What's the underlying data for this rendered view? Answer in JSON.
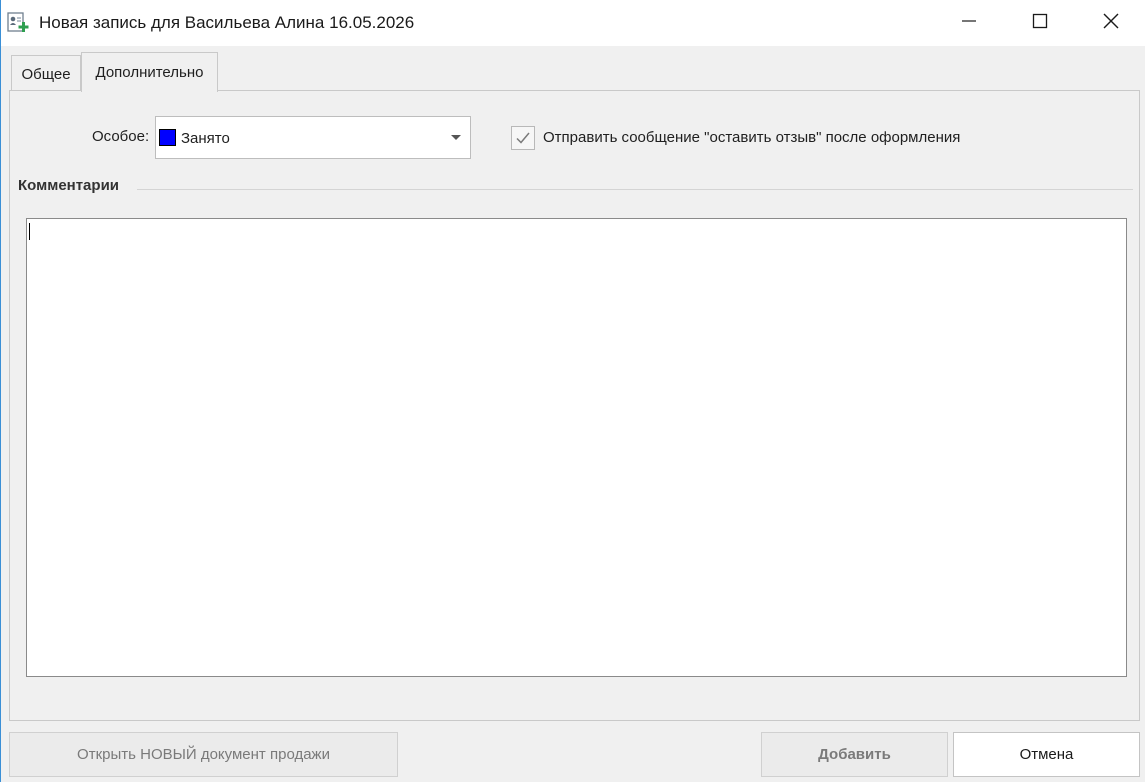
{
  "window": {
    "title": "Новая запись для Васильева Алина 16.05.2026"
  },
  "tabs": [
    {
      "label": "Общее",
      "active": false
    },
    {
      "label": "Дополнительно",
      "active": true
    }
  ],
  "special": {
    "label": "Особое:",
    "selected_value": "Занято",
    "swatch_color": "#0000ff",
    "icon": "chevron-down-icon"
  },
  "feedback_checkbox": {
    "label": "Отправить сообщение \"оставить отзыв\" после оформления",
    "checked": true
  },
  "comments": {
    "title": "Комментарии",
    "value": ""
  },
  "buttons": {
    "open_new_doc": "Открыть НОВЫЙ документ продажи",
    "add": "Добавить",
    "cancel": "Отмена"
  },
  "colors": {
    "accent": "#3a8fd6",
    "window_bg": "#f0f0f0"
  }
}
